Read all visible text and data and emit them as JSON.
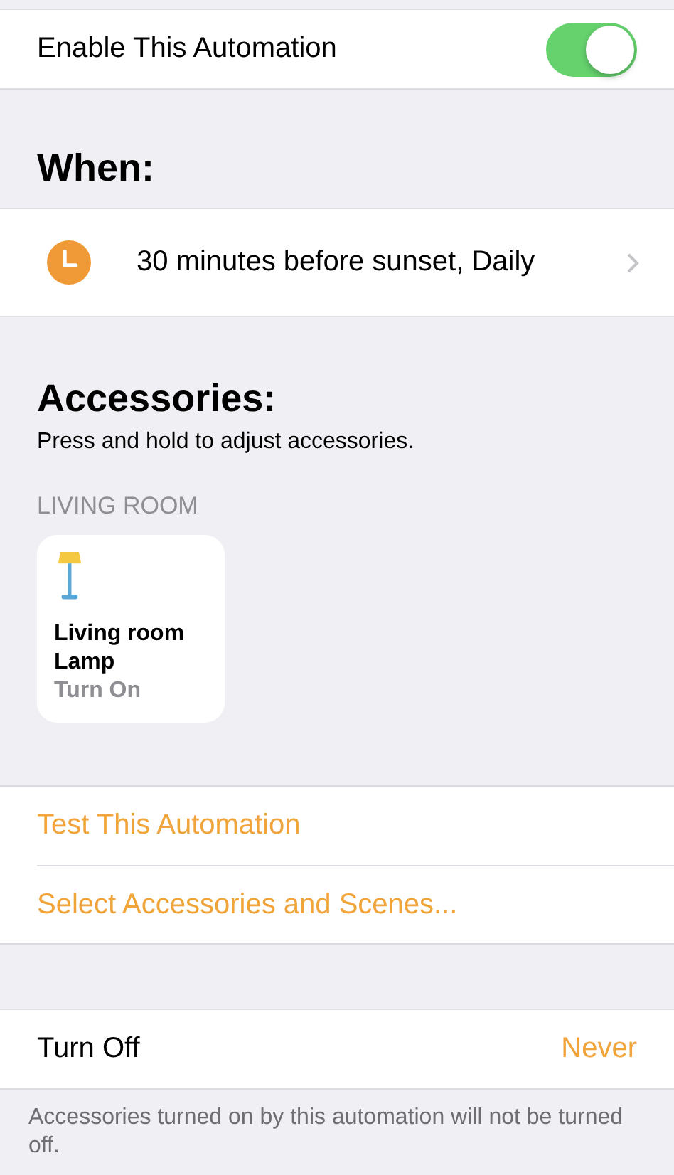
{
  "enable": {
    "label": "Enable This Automation",
    "on": true
  },
  "when": {
    "heading": "When:",
    "trigger": "30 minutes before sunset, Daily"
  },
  "accessories": {
    "heading": "Accessories:",
    "hint": "Press and hold to adjust accessories.",
    "room": "LIVING ROOM",
    "tiles": [
      {
        "name": "Living room Lamp",
        "action": "Turn On"
      }
    ]
  },
  "actions": [
    "Test This Automation",
    "Select Accessories and Scenes..."
  ],
  "turn_off": {
    "label": "Turn Off",
    "value": "Never",
    "footer": "Accessories turned on by this automation will not be turned off."
  }
}
